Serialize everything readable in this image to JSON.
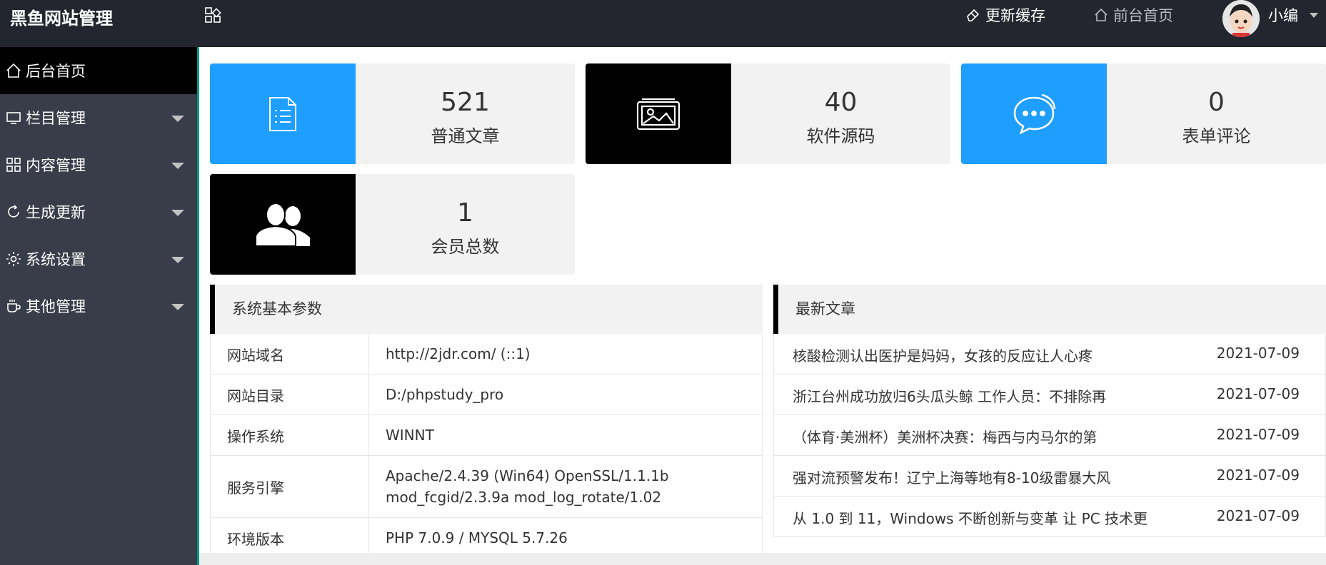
{
  "header": {
    "logo": "黑鱼网站管理",
    "cache_label": "更新缓存",
    "front_label": "前台首页",
    "username": "小编"
  },
  "sidebar": {
    "items": [
      {
        "label": "后台首页",
        "icon": "home-icon",
        "active": true
      },
      {
        "label": "栏目管理",
        "icon": "monitor-icon"
      },
      {
        "label": "内容管理",
        "icon": "grid-icon"
      },
      {
        "label": "生成更新",
        "icon": "refresh-icon"
      },
      {
        "label": "系统设置",
        "icon": "gear-icon"
      },
      {
        "label": "其他管理",
        "icon": "cup-icon"
      }
    ]
  },
  "stats": [
    {
      "value": "521",
      "label": "普通文章",
      "icon": "document-icon",
      "color": "#1e9fff"
    },
    {
      "value": "40",
      "label": "软件源码",
      "icon": "image-icon",
      "color": "#000000"
    },
    {
      "value": "0",
      "label": "表单评论",
      "icon": "chat-icon",
      "color": "#1e9fff"
    },
    {
      "value": "1",
      "label": "会员总数",
      "icon": "users-icon",
      "color": "#000000"
    }
  ],
  "sysinfo": {
    "title": "系统基本参数",
    "rows": [
      {
        "k": "网站域名",
        "v": "http://2jdr.com/ (::1)"
      },
      {
        "k": "网站目录",
        "v": "D:/phpstudy_pro"
      },
      {
        "k": "操作系统",
        "v": "WINNT"
      },
      {
        "k": "服务引擎",
        "v": "Apache/2.4.39 (Win64) OpenSSL/1.1.1b mod_fcgid/2.3.9a mod_log_rotate/1.02"
      },
      {
        "k": "环境版本",
        "v": "PHP 7.0.9 / MYSQL 5.7.26"
      }
    ]
  },
  "articles": {
    "title": "最新文章",
    "rows": [
      {
        "t": "核酸检测认出医护是妈妈，女孩的反应让人心疼",
        "d": "2021-07-09"
      },
      {
        "t": "浙江台州成功放归6头瓜头鲸 工作人员：不排除再",
        "d": "2021-07-09"
      },
      {
        "t": "（体育·美洲杯）美洲杯决赛：梅西与内马尔的第",
        "d": "2021-07-09"
      },
      {
        "t": "强对流预警发布！辽宁上海等地有8-10级雷暴大风",
        "d": "2021-07-09"
      },
      {
        "t": "从 1.0 到 11，Windows 不断创新与变革 让 PC 技术更",
        "d": "2021-07-09"
      }
    ]
  }
}
